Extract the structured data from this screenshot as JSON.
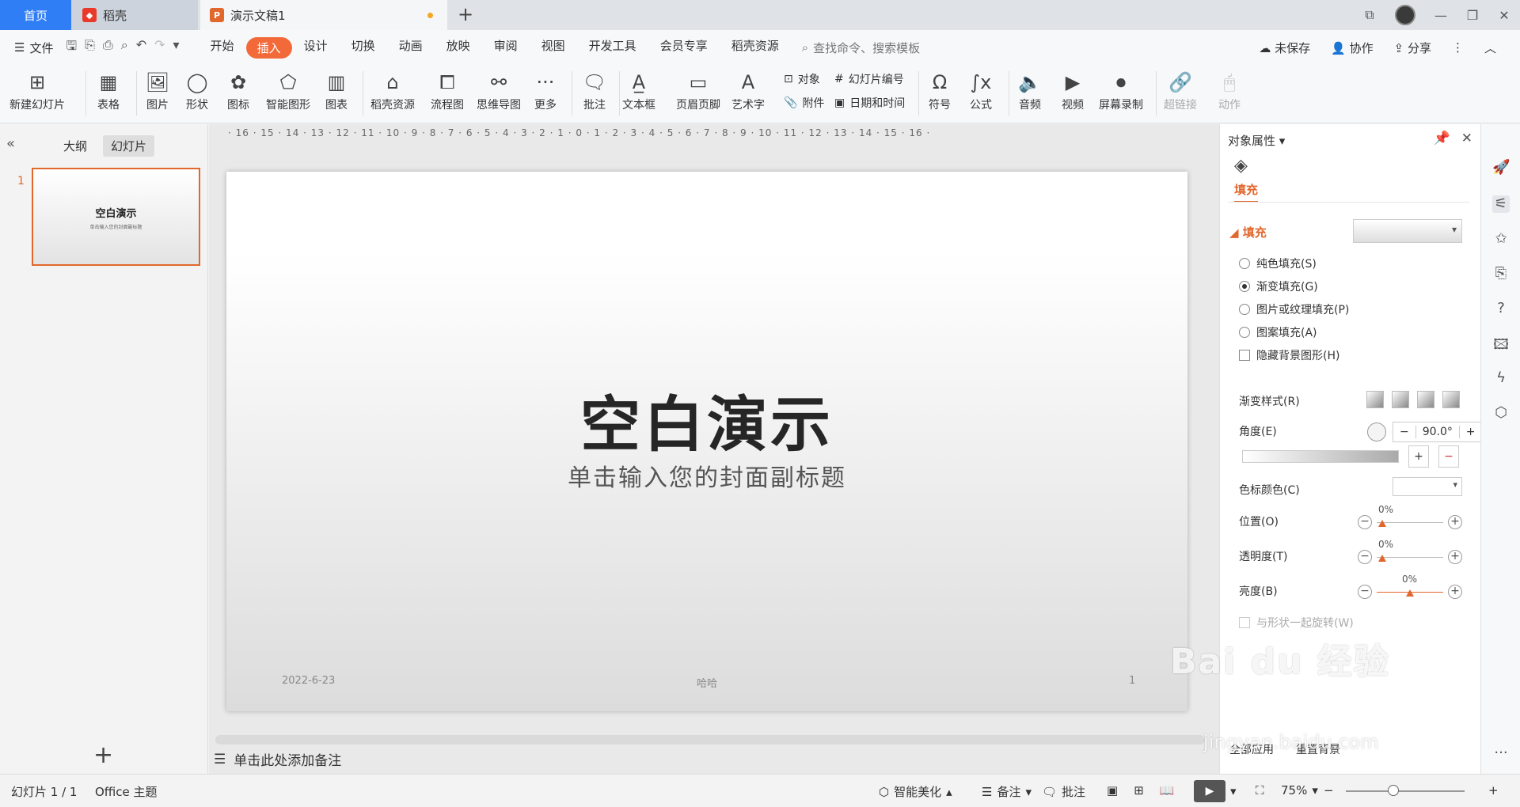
{
  "tabs": {
    "home": "首页",
    "daoke": "稻壳",
    "doc": "演示文稿1"
  },
  "menu": {
    "file": "文件",
    "items": [
      "开始",
      "插入",
      "设计",
      "切换",
      "动画",
      "放映",
      "审阅",
      "视图",
      "开发工具",
      "会员专享",
      "稻壳资源"
    ],
    "active": "插入",
    "search_placeholder": "查找命令、搜索模板",
    "unsaved": "未保存",
    "collab": "协作",
    "share": "分享"
  },
  "ribbon": {
    "new_slide": "新建幻灯片",
    "table": "表格",
    "picture": "图片",
    "shape": "形状",
    "icon": "图标",
    "smartart": "智能图形",
    "chart": "图表",
    "daoke_res": "稻壳资源",
    "flowchart": "流程图",
    "mindmap": "思维导图",
    "more": "更多",
    "comment": "批注",
    "textbox": "文本框",
    "header_footer": "页眉页脚",
    "wordart": "艺术字",
    "object": "对象",
    "slide_number": "幻灯片编号",
    "attachment": "附件",
    "datetime": "日期和时间",
    "symbol": "符号",
    "formula": "公式",
    "audio": "音频",
    "video": "视频",
    "screen_record": "屏幕录制",
    "hyperlink": "超链接",
    "action": "动作"
  },
  "left": {
    "outline": "大纲",
    "slides": "幻灯片",
    "slide_num": "1",
    "thumb_title": "空白演示",
    "thumb_sub": "单击输入您的封面副标题"
  },
  "ruler": "· 16 · 15 · 14 · 13 · 12 · 11 · 10 · 9 · 8 · 7 · 6 · 5 · 4 · 3 · 2 · 1 · 0 · 1 · 2 · 3 · 4 · 5 · 6 · 7 · 8 · 9 · 10 · 11 · 12 · 13 · 14 · 15 · 16 ·",
  "slide": {
    "title": "空白演示",
    "subtitle": "单击输入您的封面副标题",
    "date": "2022-6-23",
    "footer": "哈哈",
    "page": "1"
  },
  "notes": "单击此处添加备注",
  "props": {
    "header": "对象属性",
    "fill_tab": "填充",
    "fill_section": "填充",
    "options": [
      "纯色填充(S)",
      "渐变填充(G)",
      "图片或纹理填充(P)",
      "图案填充(A)"
    ],
    "hide_bg": "隐藏背景图形(H)",
    "gradient_style": "渐变样式(R)",
    "angle_label": "角度(E)",
    "angle_value": "90.0°",
    "stop_color": "色标颜色(C)",
    "position": "位置(O)",
    "position_val": "0%",
    "transparency": "透明度(T)",
    "transparency_val": "0%",
    "brightness": "亮度(B)",
    "brightness_val": "0%",
    "rotate_with_shape": "与形状一起旋转(W)",
    "apply_all": "全部应用",
    "reset_bg": "重置背景"
  },
  "status": {
    "slide_info": "幻灯片 1 / 1",
    "theme": "Office 主题",
    "beautify": "智能美化",
    "notes": "备注",
    "comment": "批注",
    "zoom": "75%"
  },
  "watermark": {
    "main": "Bai du 经验",
    "sub": "jingyan.baidu.com"
  },
  "colors": {
    "accent": "#e2672c",
    "home_tab": "#2f7ef5"
  }
}
